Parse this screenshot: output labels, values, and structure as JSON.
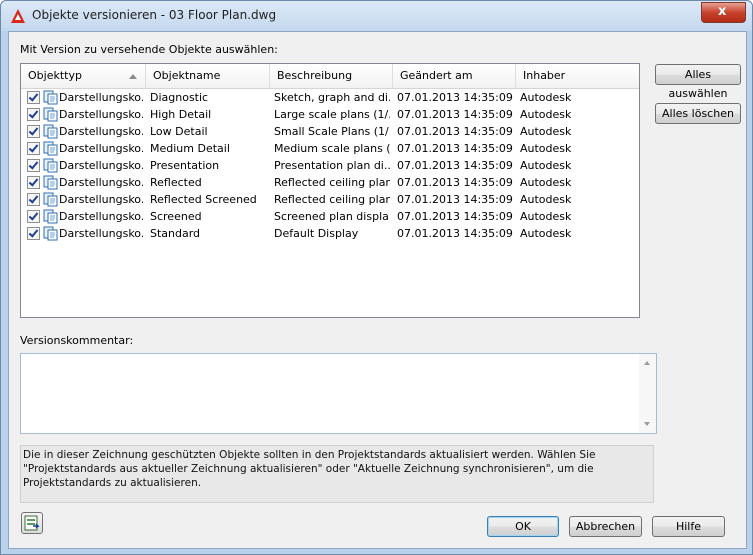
{
  "window": {
    "title": "Objekte versionieren - 03 Floor Plan.dwg",
    "close_label": "x",
    "icon": "autocad-a-icon"
  },
  "list": {
    "label": "Mit Version zu versehende Objekte auswählen:",
    "columns": [
      "Objekttyp",
      "Objektname",
      "Beschreibung",
      "Geändert am",
      "Inhaber"
    ],
    "rows": [
      {
        "type": "Darstellungsko...",
        "name": "Diagnostic",
        "desc": "Sketch, graph and di...",
        "date": "07.01.2013 14:35:09",
        "owner": "Autodesk"
      },
      {
        "type": "Darstellungsko...",
        "name": "High Detail",
        "desc": "Large scale plans (1/...",
        "date": "07.01.2013 14:35:09",
        "owner": "Autodesk"
      },
      {
        "type": "Darstellungsko...",
        "name": "Low Detail",
        "desc": "Small Scale Plans (1/...",
        "date": "07.01.2013 14:35:09",
        "owner": "Autodesk"
      },
      {
        "type": "Darstellungsko...",
        "name": "Medium Detail",
        "desc": "Medium scale plans (...",
        "date": "07.01.2013 14:35:09",
        "owner": "Autodesk"
      },
      {
        "type": "Darstellungsko...",
        "name": "Presentation",
        "desc": "Presentation plan di...",
        "date": "07.01.2013 14:35:09",
        "owner": "Autodesk"
      },
      {
        "type": "Darstellungsko...",
        "name": "Reflected",
        "desc": "Reflected ceiling plans",
        "date": "07.01.2013 14:35:09",
        "owner": "Autodesk"
      },
      {
        "type": "Darstellungsko...",
        "name": "Reflected Screened",
        "desc": "Reflected ceiling plans",
        "date": "07.01.2013 14:35:09",
        "owner": "Autodesk"
      },
      {
        "type": "Darstellungsko...",
        "name": "Screened",
        "desc": "Screened plan displa...",
        "date": "07.01.2013 14:35:09",
        "owner": "Autodesk"
      },
      {
        "type": "Darstellungsko...",
        "name": "Standard",
        "desc": "Default Display",
        "date": "07.01.2013 14:35:09",
        "owner": "Autodesk"
      }
    ]
  },
  "buttons": {
    "select_all": "Alles auswählen",
    "clear_all": "Alles löschen",
    "ok": "OK",
    "cancel": "Abbrechen",
    "help": "Hilfe"
  },
  "comment": {
    "label": "Versionskommentar:",
    "value": ""
  },
  "info_text": "Die in dieser Zeichnung geschützten Objekte sollten in den Projektstandards aktualisiert werden. Wählen Sie \"Projektstandards aus aktueller Zeichnung aktualisieren\" oder \"Aktuelle Zeichnung synchronisieren\", um die Projektstandards zu aktualisieren.",
  "colors": {
    "accent": "#3c7fb1",
    "close": "#c7432d"
  }
}
